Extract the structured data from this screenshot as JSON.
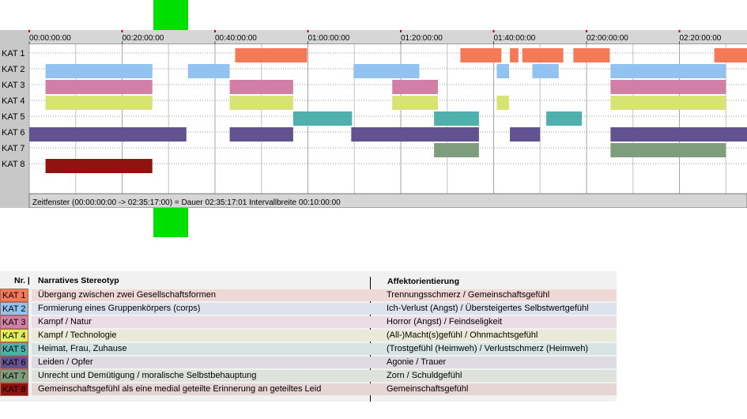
{
  "chart_data": {
    "type": "gantt",
    "time_axis": {
      "start": "00:00:00:00",
      "end": "02:35:17:00",
      "ticks": [
        "00:00:00:00",
        "00:20:00:00",
        "00:40:00:00",
        "01:00:00:00",
        "01:20:00:00",
        "01:40:00:00",
        "02:00:00:00",
        "02:20:00:00"
      ],
      "tick_seconds": [
        0,
        1200,
        2400,
        3600,
        4800,
        6000,
        7200,
        8400
      ],
      "grid_minor_interval_seconds": 600
    },
    "status_text": "Zeitfenster (00:00:00:00 -> 02:35:17:00) = Dauer 02:35:17:01     Intervallbreite 00:10:00:00",
    "categories": [
      {
        "label": "KAT 1",
        "color": "#f47a57",
        "segments": [
          [
            2660,
            3590
          ],
          [
            5570,
            6100
          ],
          [
            6210,
            6320
          ],
          [
            6370,
            6900
          ],
          [
            7030,
            7500
          ],
          [
            8850,
            9317
          ]
        ]
      },
      {
        "label": "KAT 2",
        "color": "#92c2ef",
        "segments": [
          [
            210,
            1590
          ],
          [
            2050,
            2590
          ],
          [
            4190,
            5040
          ],
          [
            6040,
            6200
          ],
          [
            6500,
            6840
          ],
          [
            7510,
            9000
          ]
        ]
      },
      {
        "label": "KAT 3",
        "color": "#d17fa6",
        "segments": [
          [
            210,
            1590
          ],
          [
            2590,
            3410
          ],
          [
            4690,
            5280
          ],
          [
            7510,
            9000
          ]
        ]
      },
      {
        "label": "KAT 4",
        "color": "#d7e473",
        "segments": [
          [
            210,
            1590
          ],
          [
            2590,
            3410
          ],
          [
            4690,
            5280
          ],
          [
            6040,
            6200
          ],
          [
            7510,
            9000
          ]
        ]
      },
      {
        "label": "KAT 5",
        "color": "#4fb0ae",
        "segments": [
          [
            3410,
            4170
          ],
          [
            5230,
            5810
          ],
          [
            6680,
            7140
          ]
        ]
      },
      {
        "label": "KAT 6",
        "color": "#625290",
        "segments": [
          [
            0,
            2030
          ],
          [
            2590,
            3410
          ],
          [
            4160,
            5810
          ],
          [
            6210,
            6600
          ],
          [
            7510,
            9317
          ]
        ]
      },
      {
        "label": "KAT 7",
        "color": "#7d9d7d",
        "segments": [
          [
            5230,
            5810
          ],
          [
            7510,
            9000
          ]
        ]
      },
      {
        "label": "KAT 8",
        "color": "#8f1410",
        "segments": [
          [
            210,
            1590
          ]
        ]
      }
    ]
  },
  "legend": {
    "col_nr": "Nr. |",
    "col_stereotype": "Narratives Stereotyp",
    "col_affect": "Affektorientierung",
    "rows": [
      {
        "kat": "KAT 1",
        "color": "#f47a57",
        "bg": "#efd9d6",
        "stereotype": "Übergang zwischen zwei Gesellschaftsformen",
        "affect": "Trennungsschmerz / Gemeinschaftsgefühl"
      },
      {
        "kat": "KAT 2",
        "color": "#92c2ef",
        "bg": "#dde3ec",
        "stereotype": "Formierung eines Gruppenkörpers (corps)",
        "affect": "Ich-Verlust (Angst) / Übersteigertes Selbstwertgefühl"
      },
      {
        "kat": "KAT 3",
        "color": "#d17fa6",
        "bg": "#ecdde4",
        "stereotype": "Kampf / Natur",
        "affect": "Horror (Angst) / Feindseligkeit"
      },
      {
        "kat": "KAT 4",
        "color": "#e4ee55",
        "bg": "#e9ebd8",
        "stereotype": "Kampf / Technologie",
        "affect": "(All-)Macht(s)gefühl / Ohnmachtsgefühl"
      },
      {
        "kat": "KAT 5",
        "color": "#4fb0ae",
        "bg": "#d6e5e3",
        "stereotype": "Heimat, Frau, Zuhause",
        "affect": "(Trostgefühl (Heimweh) / Verlustschmerz (Heimweh)"
      },
      {
        "kat": "KAT 6",
        "color": "#625290",
        "bg": "#dedbe3",
        "stereotype": "Leiden / Opfer",
        "affect": "Agonie / Trauer"
      },
      {
        "kat": "KAT 7",
        "color": "#7d9d7d",
        "bg": "#dde2dc",
        "stereotype": "Unrecht und Demütigung / moralische Selbstbehauptung",
        "affect": "Zorn / Schuldgefühl"
      },
      {
        "kat": "KAT 8",
        "color": "#8f1410",
        "bg": "#e6d5d5",
        "stereotype": "Gemeinschaftsgefühl als eine medial geteilte Erinnerung an geteiltes Leid",
        "affect": "Gemeinschaftsgefühl"
      }
    ]
  }
}
